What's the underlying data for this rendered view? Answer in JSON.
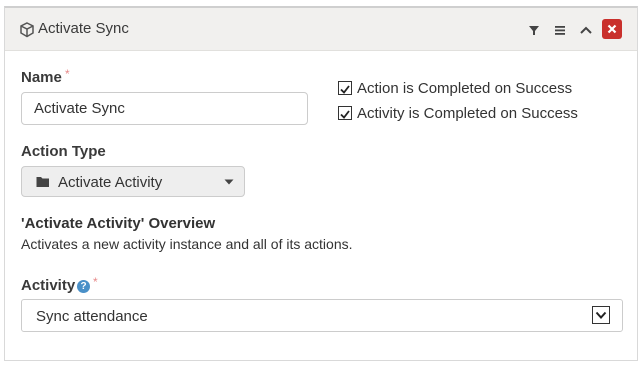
{
  "panel": {
    "title": "Activate Sync",
    "title_icon": "cube-icon",
    "header_buttons": [
      "filter-icon",
      "menu-icon",
      "chevron-up-icon",
      "close-icon"
    ],
    "close_color": "#c9302c"
  },
  "form": {
    "name_label": "Name",
    "name_value": "Activate Sync",
    "required_marker": "*",
    "checkbox_action_completed": {
      "label": "Action is Completed on Success",
      "checked": true
    },
    "checkbox_activity_completed": {
      "label": "Activity is Completed on Success",
      "checked": true
    },
    "action_type_label": "Action Type",
    "action_type_value": "Activate Activity",
    "overview_title": "'Activate Activity' Overview",
    "overview_desc": "Activates a new activity instance and all of its actions.",
    "activity_label": "Activity",
    "activity_value": "Sync attendance",
    "help_glyph": "?"
  }
}
